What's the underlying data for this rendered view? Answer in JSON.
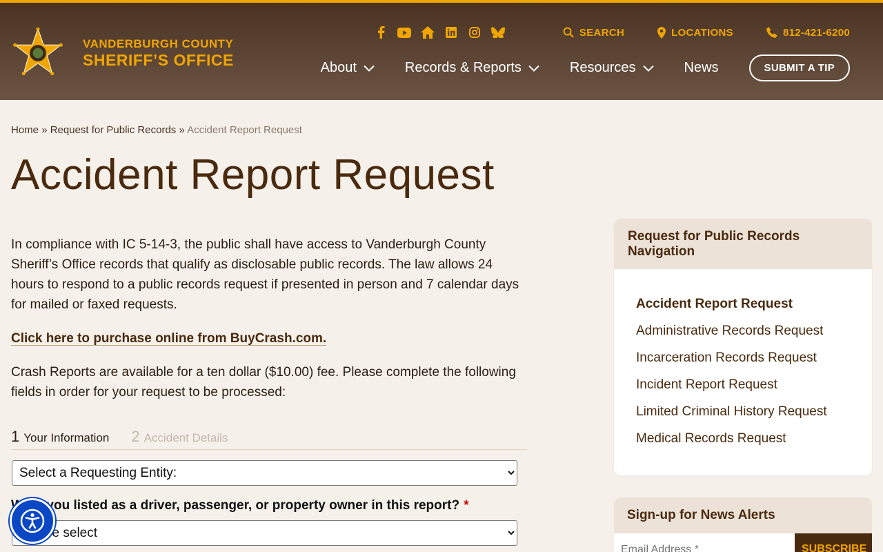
{
  "header": {
    "logo_line1": "VANDERBURGH COUNTY",
    "logo_line2": "SHERIFF’S OFFICE",
    "socials": [
      "facebook-icon",
      "youtube-icon",
      "home-icon",
      "linkedin-icon",
      "instagram-icon",
      "bluesky-icon"
    ],
    "search_label": "SEARCH",
    "locations_label": "LOCATIONS",
    "phone_label": "812-421-6200",
    "nav": [
      {
        "label": "About"
      },
      {
        "label": "Records & Reports"
      },
      {
        "label": "Resources"
      },
      {
        "label": "News"
      }
    ],
    "tip_button": "SUBMIT A TIP",
    "accent_color": "#f0a500"
  },
  "breadcrumb": {
    "home": "Home",
    "sep": "»",
    "parent": "Request for Public Records",
    "current": "Accident Report Request"
  },
  "page_title": "Accident Report Request",
  "main": {
    "intro": "In compliance with IC 5-14-3, the public shall have access to Vanderburgh County Sheriff’s Office records that qualify as disclosable public records. The law allows 24 hours to respond to a public records request if presented in person and 7 calendar days for mailed or faxed requests.",
    "buy_link": "Click here to purchase online from BuyCrash.com.",
    "fee_text": "Crash Reports are available for a ten dollar ($10.00) fee. Please complete the following fields in order for your request to be processed:"
  },
  "form": {
    "steps": [
      {
        "num": "1",
        "label": "Your Information"
      },
      {
        "num": "2",
        "label": "Accident Details"
      }
    ],
    "entity_select": "Select a Requesting Entity:",
    "question_label": "Were you listed as a driver, passenger, or property owner in this report?",
    "required_mark": "*",
    "question_select": "Please select"
  },
  "sidebar": {
    "title": "Request for Public Records Navigation",
    "items": [
      {
        "label": "Accident Report Request"
      },
      {
        "label": "Administrative Records Request"
      },
      {
        "label": "Incarceration Records Request"
      },
      {
        "label": "Incident Report Request"
      },
      {
        "label": "Limited Criminal History Request"
      },
      {
        "label": "Medical Records Request"
      }
    ]
  },
  "news": {
    "title": "Sign-up for News Alerts",
    "email_placeholder": "Email Address *",
    "subscribe": "SUBSCRIBE"
  }
}
